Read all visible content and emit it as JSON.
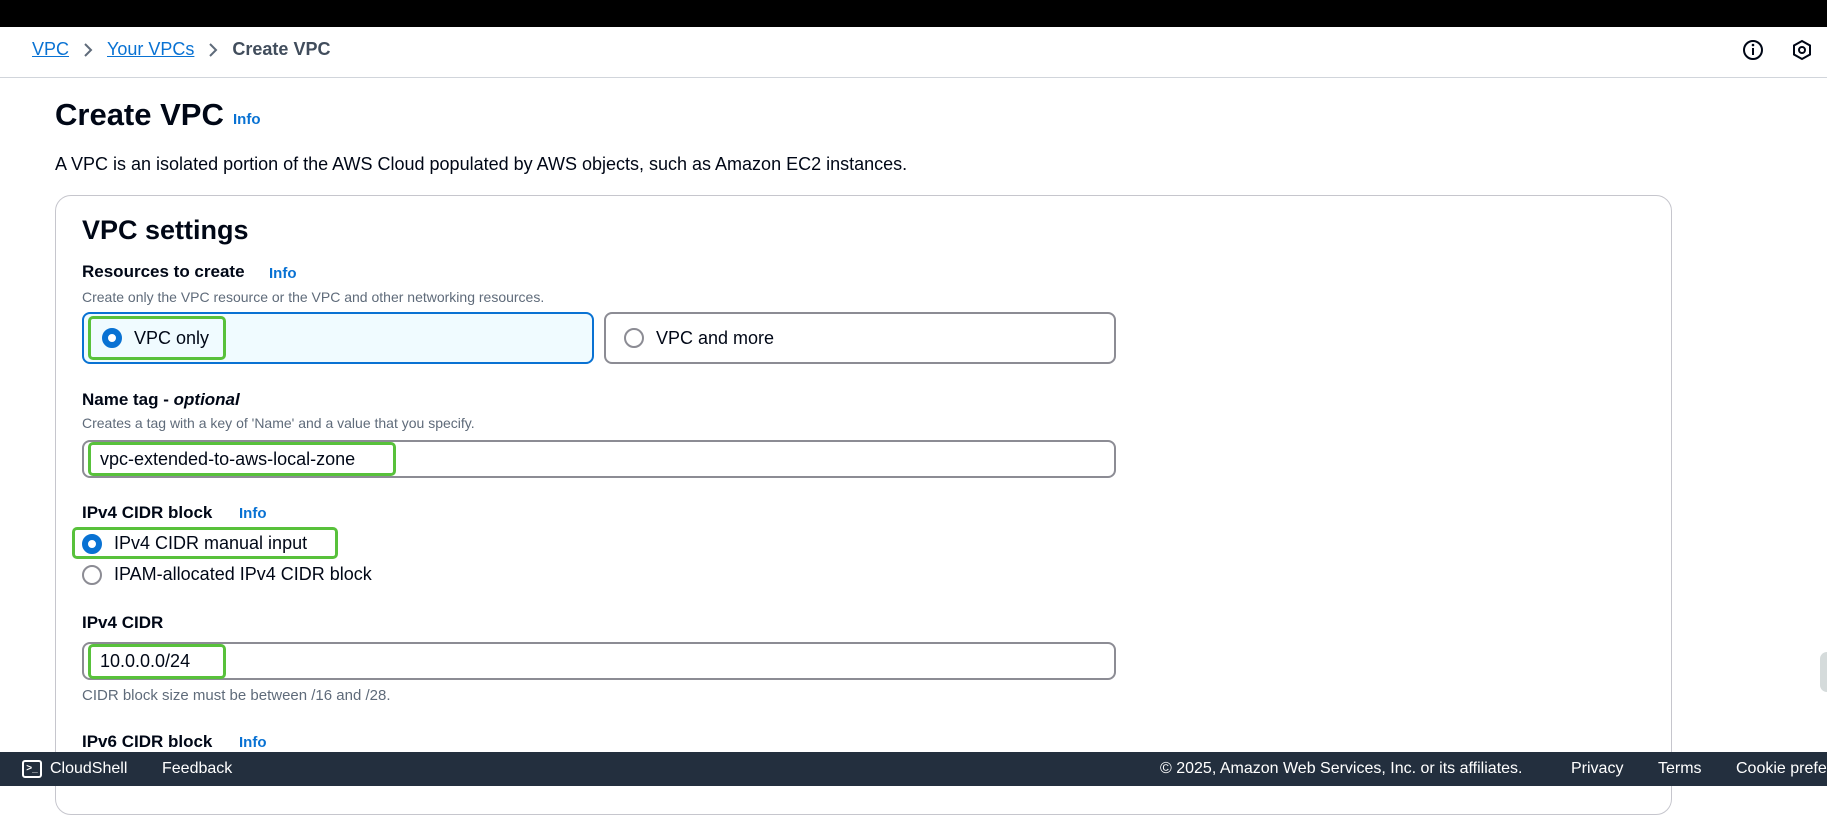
{
  "breadcrumb": {
    "items": [
      "VPC",
      "Your VPCs"
    ],
    "current": "Create VPC"
  },
  "page": {
    "title": "Create VPC",
    "title_info": "Info",
    "description": "A VPC is an isolated portion of the AWS Cloud populated by AWS objects, such as Amazon EC2 instances."
  },
  "vpc_settings": {
    "title": "VPC settings",
    "resources": {
      "label": "Resources to create",
      "info": "Info",
      "description": "Create only the VPC resource or the VPC and other networking resources.",
      "options": [
        "VPC only",
        "VPC and more"
      ],
      "selected": "VPC only"
    },
    "name_tag": {
      "label": "Name tag - ",
      "label_optional": "optional",
      "description": "Creates a tag with a key of 'Name' and a value that you specify.",
      "value": "vpc-extended-to-aws-local-zone"
    },
    "ipv4_cidr_block": {
      "label": "IPv4 CIDR block",
      "info": "Info",
      "options": [
        "IPv4 CIDR manual input",
        "IPAM-allocated IPv4 CIDR block"
      ],
      "selected": "IPv4 CIDR manual input"
    },
    "ipv4_cidr": {
      "label": "IPv4 CIDR",
      "value": "10.0.0.0/24",
      "constraint": "CIDR block size must be between /16 and /28."
    },
    "ipv6_cidr_block": {
      "label": "IPv6 CIDR block",
      "info": "Info"
    }
  },
  "footer": {
    "cloudshell": "CloudShell",
    "feedback": "Feedback",
    "copyright": "© 2025, Amazon Web Services, Inc. or its affiliates.",
    "privacy": "Privacy",
    "terms": "Terms",
    "cookie": "Cookie prefe"
  },
  "colors": {
    "link": "#0972d3",
    "highlight": "#58c13b",
    "footer_bg": "#232f3e"
  },
  "icons": [
    "info-circle-icon",
    "settings-hexagon-icon",
    "cloudshell-icon",
    "chevron-right-icon"
  ]
}
